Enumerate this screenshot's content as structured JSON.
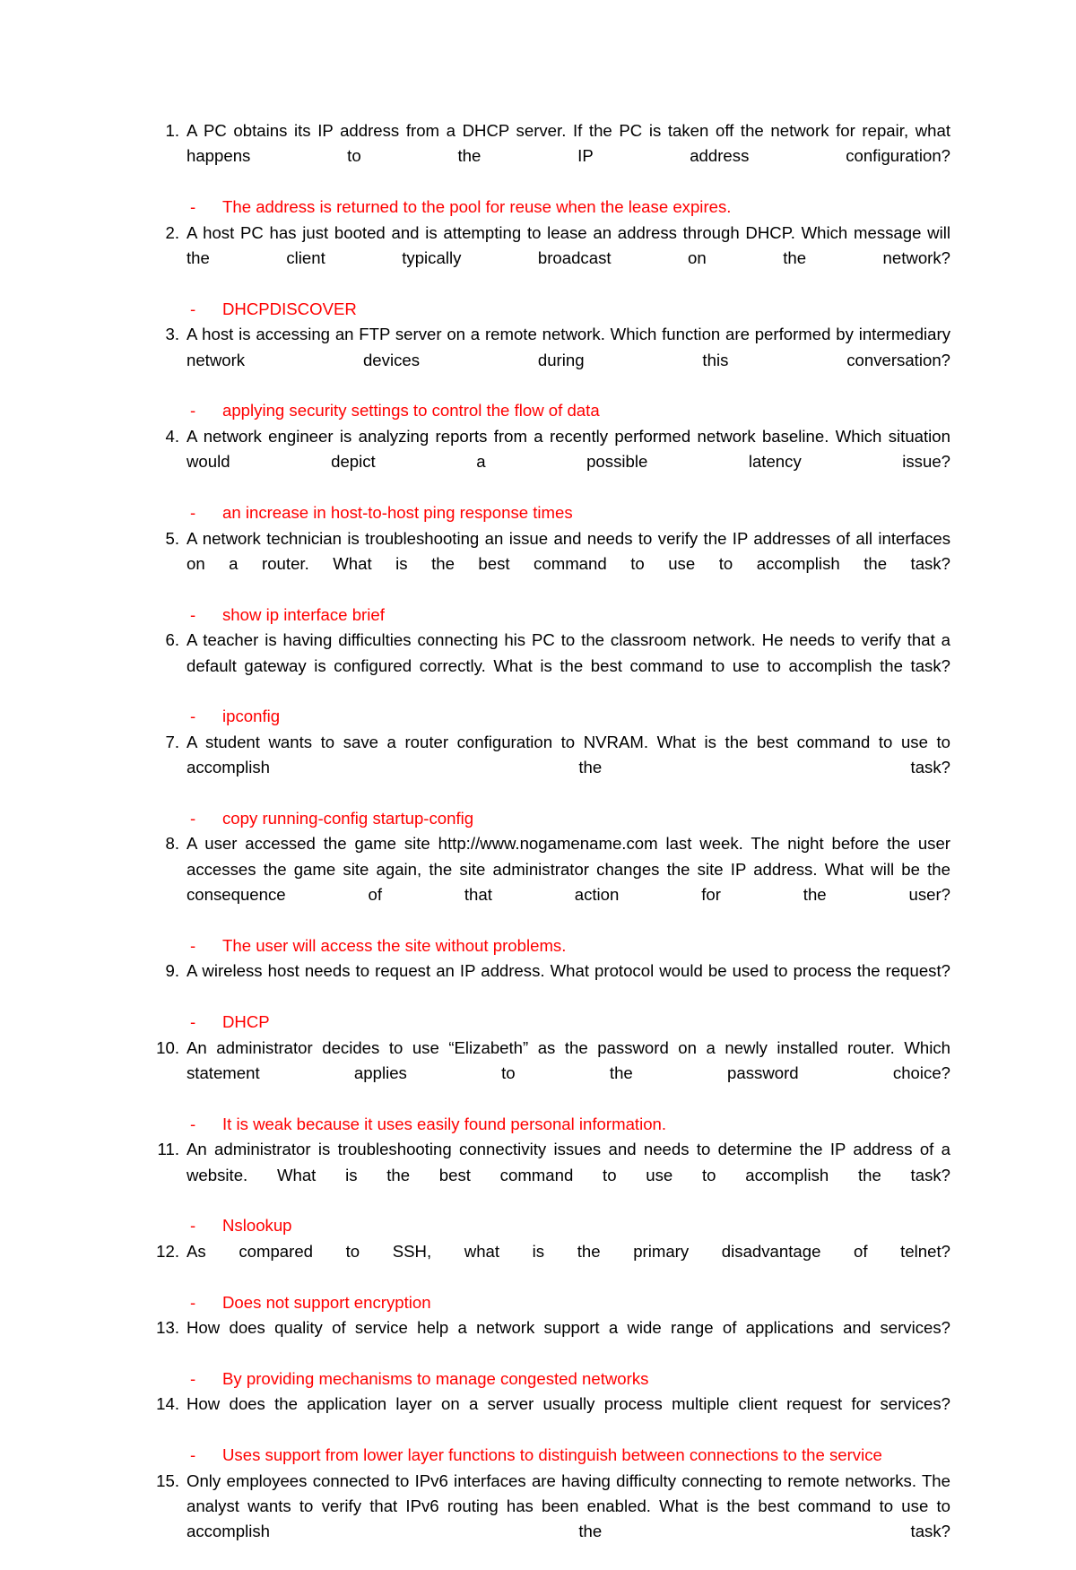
{
  "document": {
    "type": "quiz-answer-key",
    "bullet_marker": "-",
    "answer_color": "#ff0000",
    "question_color": "#000000",
    "background_color": "#ffffff",
    "items": [
      {
        "number": "1.",
        "question": "A PC obtains its IP address from a DHCP server. If the PC is taken off the network for repair, what happens to the IP address configuration?",
        "answer": "The address is returned to the pool for reuse when the lease expires."
      },
      {
        "number": "2.",
        "question": "A host PC has just booted and is attempting to lease an address through DHCP. Which message will the client typically broadcast on the network?",
        "answer": "DHCPDISCOVER"
      },
      {
        "number": "3.",
        "question": "A host is accessing an FTP server on a remote network. Which function are performed by intermediary network devices during this conversation?",
        "answer": "applying security settings to control the flow of data"
      },
      {
        "number": "4.",
        "question": "A network engineer is analyzing reports from a recently performed network baseline. Which situation would depict a possible latency issue?",
        "answer": "an increase in host-to-host ping response times"
      },
      {
        "number": "5.",
        "question": "A network technician is troubleshooting an issue and needs to verify the IP addresses of all interfaces on a router. What is the best command to use to accomplish the task?",
        "answer": "show ip interface brief"
      },
      {
        "number": "6.",
        "question": "A teacher is having difficulties connecting his PC to the classroom network. He needs to verify that a default gateway is configured correctly. What is the best command to use to accomplish the task?",
        "answer": "ipconfig"
      },
      {
        "number": "7.",
        "question": "A student wants to save a router configuration to NVRAM. What is the best command to use to accomplish the task?",
        "answer": "copy running-config startup-config"
      },
      {
        "number": "8.",
        "question": "A user accessed the game site http://www.nogamename.com last week. The night before the user accesses the game site again, the site administrator changes the site IP address. What will be the consequence of that action for the user?",
        "answer": "The user will access the site without problems."
      },
      {
        "number": "9.",
        "question": "A wireless host needs to request an IP address. What protocol would be used to process the request?",
        "answer": "DHCP"
      },
      {
        "number": "10.",
        "question": "An administrator decides to use “Elizabeth” as the password on a newly installed router. Which statement applies to the password choice?",
        "answer": "It is weak because it uses easily found personal information."
      },
      {
        "number": "11.",
        "question": "An administrator is troubleshooting connectivity issues and needs to determine the IP address of a website. What is the best command to use to accomplish the task?",
        "answer": "Nslookup"
      },
      {
        "number": "12.",
        "question": "As compared to SSH, what is the primary disadvantage of telnet?",
        "answer": "Does not support encryption"
      },
      {
        "number": "13.",
        "question": "How does quality of service help a network support a wide range of applications and services?",
        "answer": "By providing mechanisms to manage congested networks"
      },
      {
        "number": "14.",
        "question": "How does the application layer on a server usually process multiple client request for services?",
        "answer": "Uses support from lower layer functions to distinguish between connections to the service"
      },
      {
        "number": "15.",
        "question": "Only employees connected to IPv6 interfaces are having difficulty connecting to remote networks. The analyst wants to verify that IPv6 routing has been enabled. What is the best command to use to accomplish the task?",
        "answer": null
      }
    ]
  }
}
